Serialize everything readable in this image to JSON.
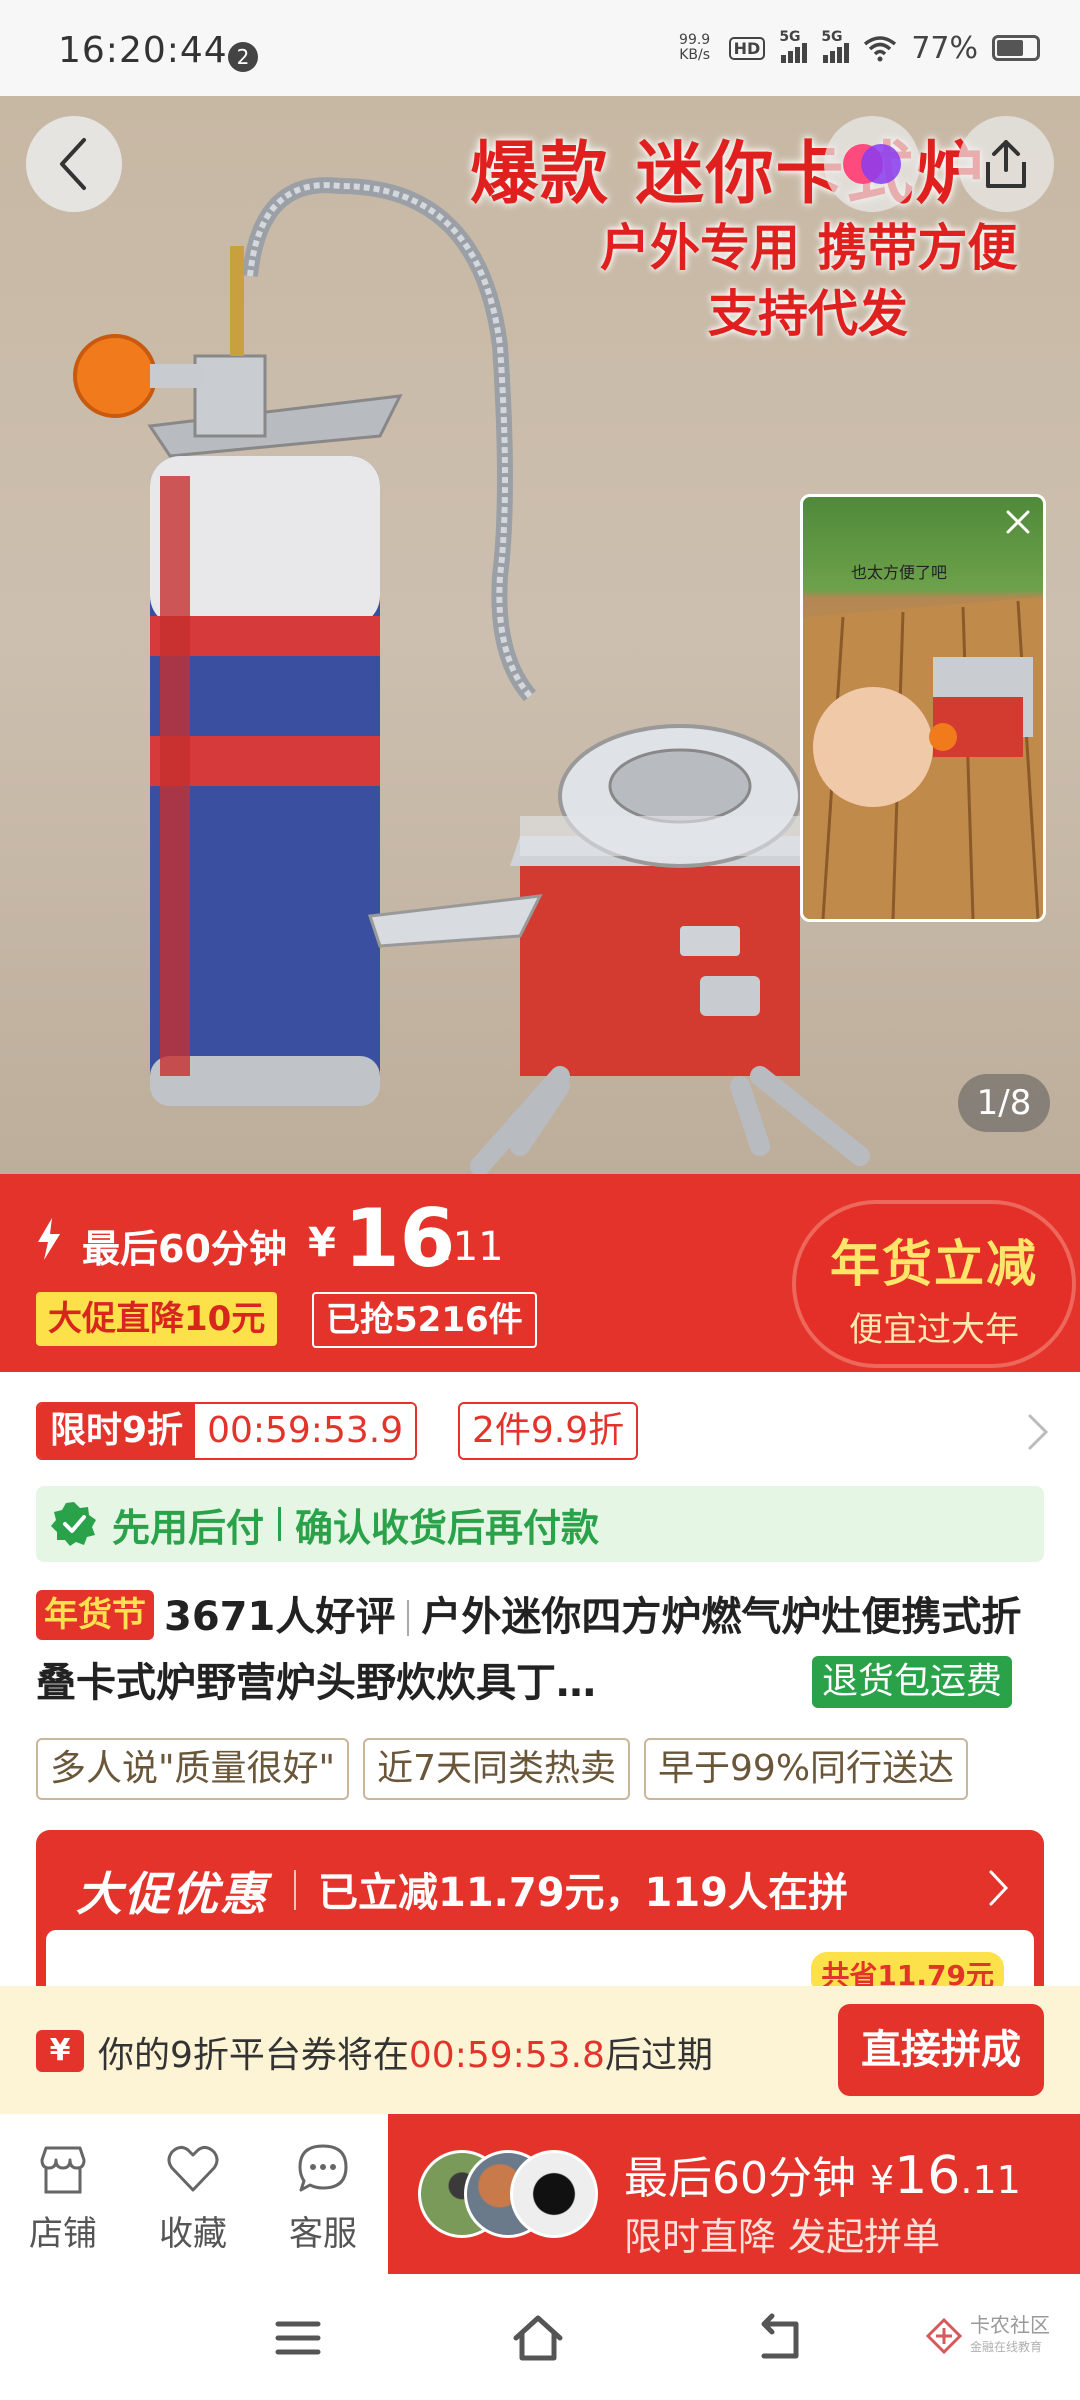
{
  "status_bar": {
    "time": "16:20:44",
    "notification_count": "2",
    "net_speed_value": "99.9",
    "net_speed_unit": "KB/s",
    "hd": "HD",
    "signal_1": "5G",
    "signal_2": "5G",
    "battery": "77%"
  },
  "hero": {
    "title": "爆款 迷你卡式炉",
    "subtitle_1": "户外专用 携带方便",
    "subtitle_2": "支持代发",
    "video_caption": "也太方便了吧",
    "page_counter": "1/8"
  },
  "price_banner": {
    "label": "最后60分钟",
    "currency": "¥",
    "price_int": "16",
    "price_dec": ".11",
    "promo_drop": "大促直降10元",
    "sold": "已抢5216件",
    "festival_title": "年货立减",
    "festival_sub": "便宜过大年"
  },
  "limited": {
    "label": "限时9折",
    "countdown": "00:59:53.9",
    "multi_discount": "2件9.9折"
  },
  "pay_later": {
    "label": "先用后付",
    "description": "确认收货后再付款"
  },
  "product": {
    "festival_tag": "年货节",
    "reviews": "3671人好评",
    "title": "户外迷你四方炉燃气炉灶便携式折叠卡式炉野营炉头野炊炊具丁…",
    "return_tag": "退货包运费"
  },
  "feature_tags": [
    "多人说\"质量很好\"",
    "近7天同类热卖",
    "早于99%同行送达"
  ],
  "promo": {
    "logo": "大促优惠",
    "text": "已立减11.79元，119人在拼",
    "save_badge": "共省11.79元"
  },
  "coupon": {
    "icon": "¥",
    "text_before": "你的9折平台券将在",
    "timer": "00:59:53.8",
    "text_after": "后过期",
    "button": "直接拼成"
  },
  "bottom_bar": {
    "shop": "店铺",
    "favorite": "收藏",
    "service": "客服",
    "buy_label": "最后60分钟",
    "buy_currency": "¥",
    "buy_price_int": "16",
    "buy_price_dec": ".11",
    "buy_sub": "限时直降 发起拼单"
  },
  "watermark": {
    "name": "卡农社区",
    "tagline": "金融在线教育"
  },
  "colors": {
    "brand_red": "#e3332b",
    "promo_yellow": "#fde14a",
    "pay_green": "#2aa24a"
  }
}
